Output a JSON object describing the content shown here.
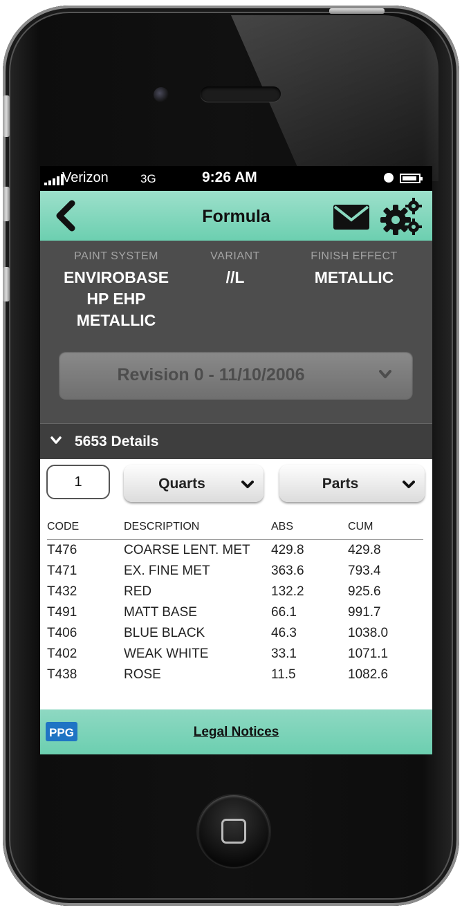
{
  "status_bar": {
    "carrier": "Verizon",
    "network": "3G",
    "time": "9:26 AM"
  },
  "nav": {
    "title": "Formula"
  },
  "paint_info": [
    {
      "label": "PAINT SYSTEM",
      "value": "ENVIROBASE\nHP EHP\nMETALLIC"
    },
    {
      "label": "VARIANT",
      "value": "//L"
    },
    {
      "label": "FINISH EFFECT",
      "value": "METALLIC"
    }
  ],
  "revision": {
    "selected": "Revision 0 - 11/10/2006"
  },
  "details": {
    "title": "5653 Details"
  },
  "controls": {
    "quantity": "1",
    "unit": "Quarts",
    "mode": "Parts"
  },
  "table": {
    "headers": [
      "CODE",
      "DESCRIPTION",
      "ABS",
      "CUM"
    ],
    "rows": [
      [
        "T476",
        "COARSE LENT. MET",
        "429.8",
        "429.8"
      ],
      [
        "T471",
        "EX. FINE MET",
        "363.6",
        "793.4"
      ],
      [
        "T432",
        "RED",
        "132.2",
        "925.6"
      ],
      [
        "T491",
        "MATT BASE",
        "66.1",
        "991.7"
      ],
      [
        "T406",
        "BLUE BLACK",
        "46.3",
        "1038.0"
      ],
      [
        "T402",
        "WEAK WHITE",
        "33.1",
        "1071.1"
      ],
      [
        "T438",
        "ROSE",
        "11.5",
        "1082.6"
      ]
    ]
  },
  "footer": {
    "logo_text": "PPG",
    "link": "Legal Notices"
  },
  "colors": {
    "accent": "#6ccfb0",
    "panel": "#4d4d4d"
  },
  "icons": [
    "back-arrow-icon",
    "mail-icon",
    "gears-icon",
    "chevron-down-icon",
    "ppg-logo-icon"
  ]
}
